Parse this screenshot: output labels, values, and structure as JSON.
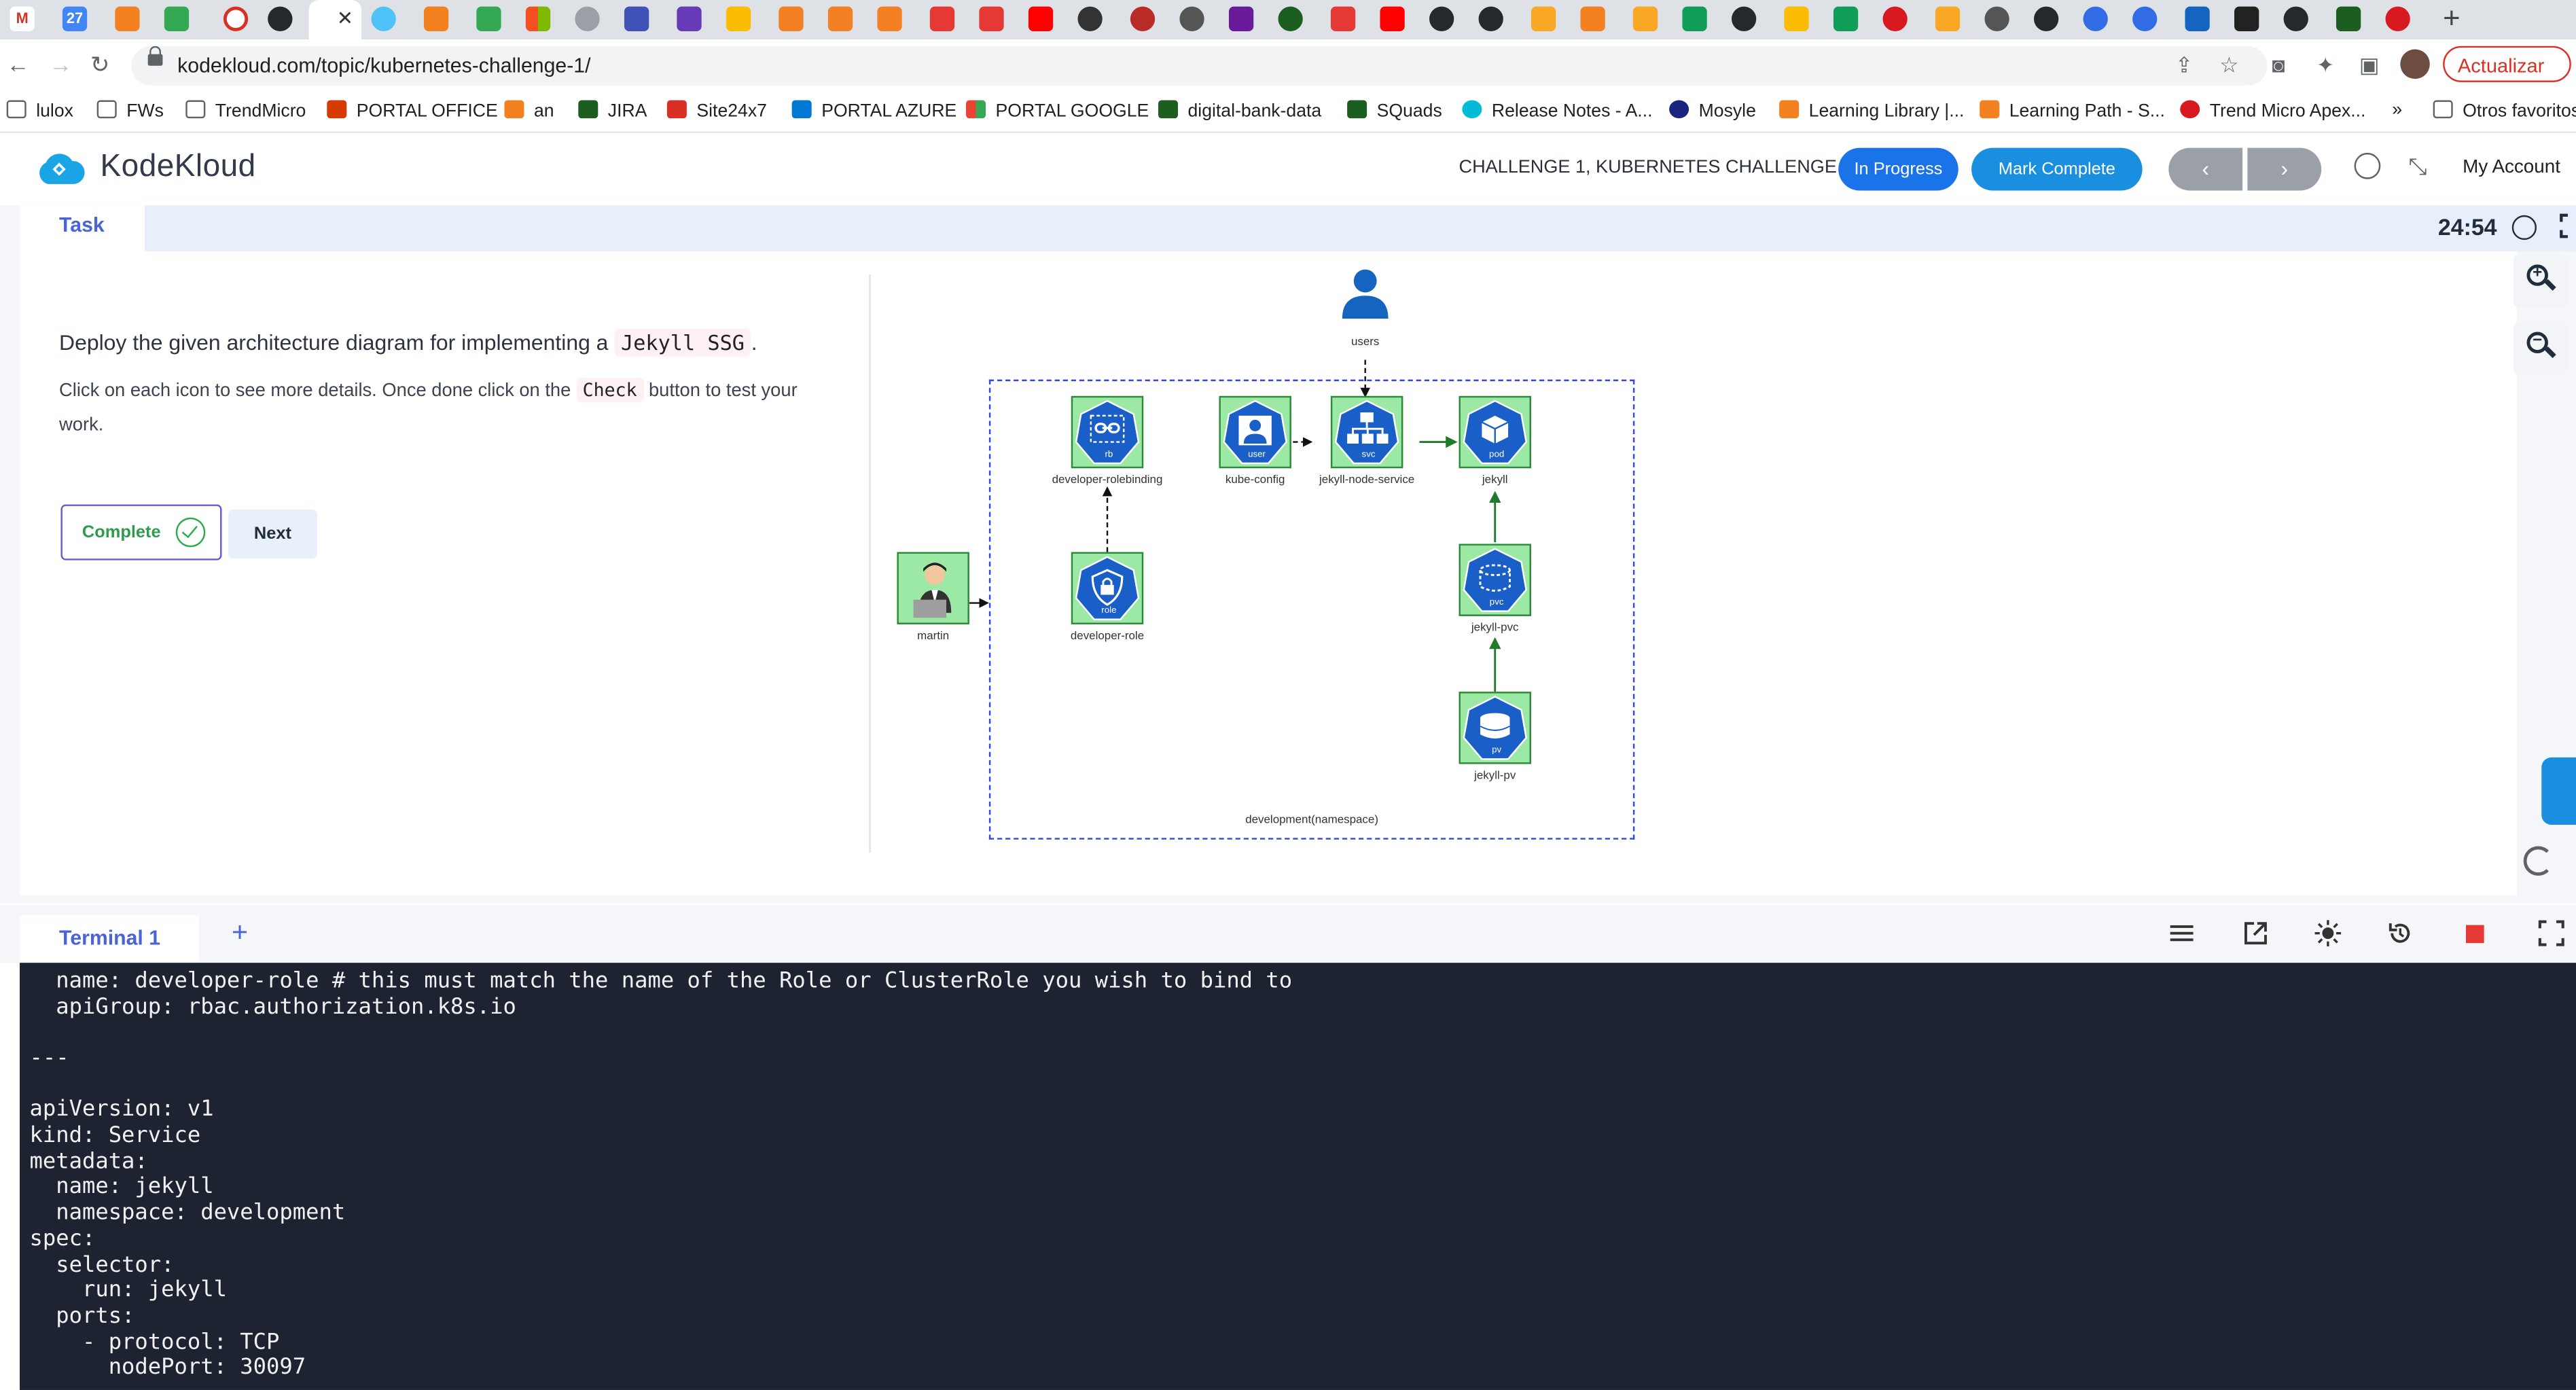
{
  "browser": {
    "url": "kodekloud.com/topic/kubernetes-challenge-1/",
    "update_label": "Actualizar",
    "bookmarks": [
      "lulox",
      "FWs",
      "TrendMicro",
      "PORTAL OFFICE",
      "an",
      "JIRA",
      "Site24x7",
      "PORTAL AZURE",
      "PORTAL GOOGLE",
      "digital-bank-data",
      "SQuads",
      "Release Notes - A...",
      "Mosyle",
      "Learning Library |...",
      "Learning Path - S...",
      "Trend Micro Apex...",
      "»",
      "Otros favoritos"
    ]
  },
  "header": {
    "logo_text": "KodeKloud",
    "challenge_title": "CHALLENGE 1, KUBERNETES CHALLENGE 1",
    "status_label": "In Progress",
    "mark_complete_label": "Mark Complete",
    "prev_label": "‹",
    "next_label": "›",
    "account_label": "My Account",
    "accent_color": "#1a73e8"
  },
  "task": {
    "tab_label": "Task",
    "timer": "24:54",
    "intro_prefix": "Deploy the given architecture diagram for implementing a",
    "intro_code": "Jekyll SSG",
    "intro_suffix": ".",
    "instr_prefix": "Click on each icon to see more details. Once done click on the",
    "instr_code": "Check",
    "instr_suffix": "button to test your work.",
    "complete_label": "Complete",
    "next_label": "Next"
  },
  "diagram": {
    "namespace_label": "development(namespace)",
    "nodes": {
      "users": "users",
      "martin": "martin",
      "rolebinding": "developer-rolebinding",
      "role": "developer-role",
      "kubeconfig": "kube-config",
      "service": "jekyll-node-service",
      "pod": "jekyll",
      "pvc": "jekyll-pvc",
      "pv": "jekyll-pv"
    },
    "tags": {
      "rb": "rb",
      "role": "role",
      "user": "user",
      "svc": "svc",
      "pod": "pod",
      "pvc": "pvc",
      "pv": "pv"
    }
  },
  "terminal": {
    "tab_label": "Terminal 1",
    "add_label": "+",
    "lines": [
      "  name: developer-role # this must match the name of the Role or ClusterRole you wish to bind to",
      "  apiGroup: rbac.authorization.k8s.io",
      "",
      "---",
      "",
      "apiVersion: v1",
      "kind: Service",
      "metadata:",
      "  name: jekyll",
      "  namespace: development",
      "spec:",
      "  selector:",
      "    run: jekyll",
      "  ports:",
      "    - protocol: TCP",
      "      nodePort: 30097"
    ]
  }
}
